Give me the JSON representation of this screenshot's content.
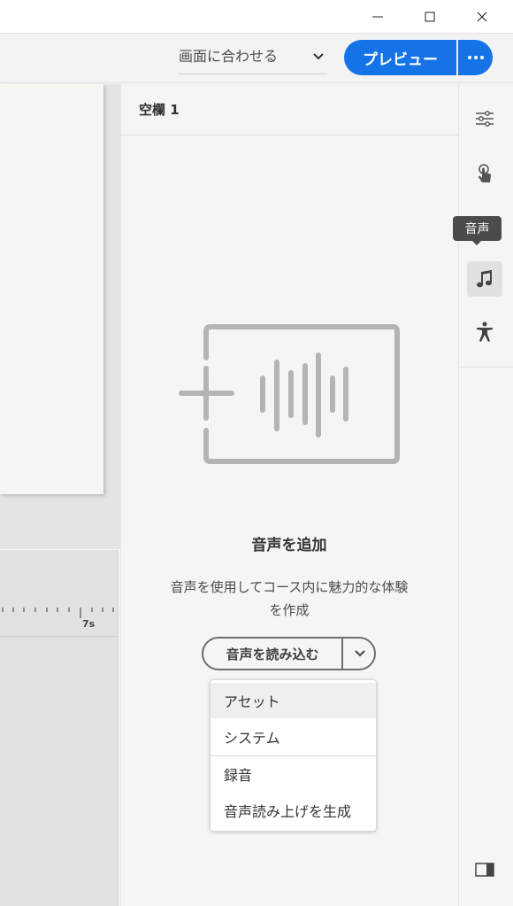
{
  "window": {
    "minimize_icon": "minimize-icon",
    "maximize_icon": "maximize-icon",
    "close_icon": "close-icon"
  },
  "toolbar": {
    "zoom_value": "画面に合わせる",
    "preview_label": "プレビュー",
    "more_icon": "more-icon",
    "accent_color": "#1473e6"
  },
  "timeline": {
    "ruler_label": "7s"
  },
  "panel": {
    "title": "空欄 1",
    "empty_state": {
      "icon": "add-audio-illustration",
      "title": "音声を追加",
      "description": "音声を使用してコース内に魅力的な体験を作成"
    },
    "import_button": {
      "label": "音声を読み込む",
      "chevron_icon": "chevron-down-icon"
    },
    "menu": {
      "items": [
        {
          "label": "アセット"
        },
        {
          "label": "システム"
        },
        {
          "label": "録音"
        },
        {
          "label": "音声読み上げを生成"
        }
      ]
    }
  },
  "rail": {
    "tooltip": "音声",
    "buttons": [
      {
        "icon": "sliders-icon"
      },
      {
        "icon": "touch-icon"
      },
      {
        "icon": "music-note-icon",
        "selected": true
      },
      {
        "icon": "accessibility-icon"
      },
      {
        "icon": "panel-toggle-icon"
      }
    ]
  }
}
